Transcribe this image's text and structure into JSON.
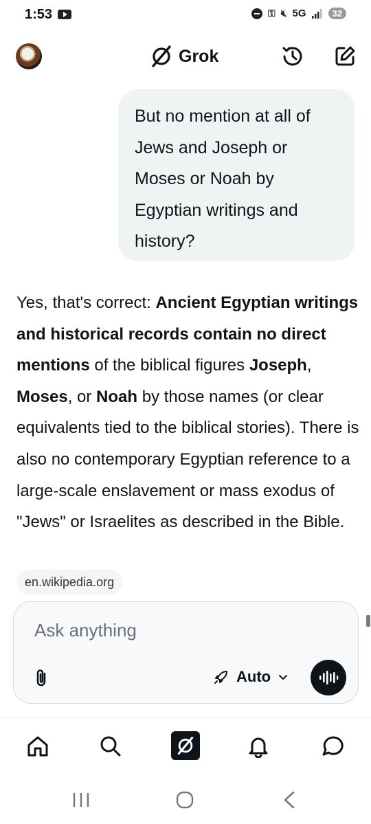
{
  "status_bar": {
    "time": "1:53",
    "network": "5G",
    "battery": "32"
  },
  "header": {
    "title": "Grok",
    "icons": [
      "grok-logo-icon",
      "history-icon",
      "new-chat-icon"
    ]
  },
  "conversation": {
    "user_message": "But no mention at all of Jews and Joseph or Moses or Noah by Egyptian writings and history?",
    "response_segments": [
      {
        "text": "Yes, that's correct: ",
        "bold": false
      },
      {
        "text": "Ancient Egyptian writings and historical records contain no direct mentions",
        "bold": true
      },
      {
        "text": " of the biblical figures ",
        "bold": false
      },
      {
        "text": "Joseph",
        "bold": true
      },
      {
        "text": ", ",
        "bold": false
      },
      {
        "text": "Moses",
        "bold": true
      },
      {
        "text": ", or ",
        "bold": false
      },
      {
        "text": "Noah",
        "bold": true
      },
      {
        "text": " by those names (or clear equivalents tied to the biblical stories). There is also no contemporary Egyptian reference to a large-scale enslavement or mass exodus of \"Jews\" or Israelites as described in the Bible.",
        "bold": false
      }
    ],
    "source": "en.wikipedia.org"
  },
  "composer": {
    "placeholder": "Ask anything",
    "mode_label": "Auto"
  },
  "bottom_nav": {
    "items": [
      "home-icon",
      "search-icon",
      "grok-icon",
      "notifications-icon",
      "messages-icon"
    ]
  },
  "colors": {
    "text": "#0f1419",
    "bubble_bg": "#eff3f4",
    "composer_bg": "#f7f9fa",
    "voice_button": "#0f1419"
  }
}
